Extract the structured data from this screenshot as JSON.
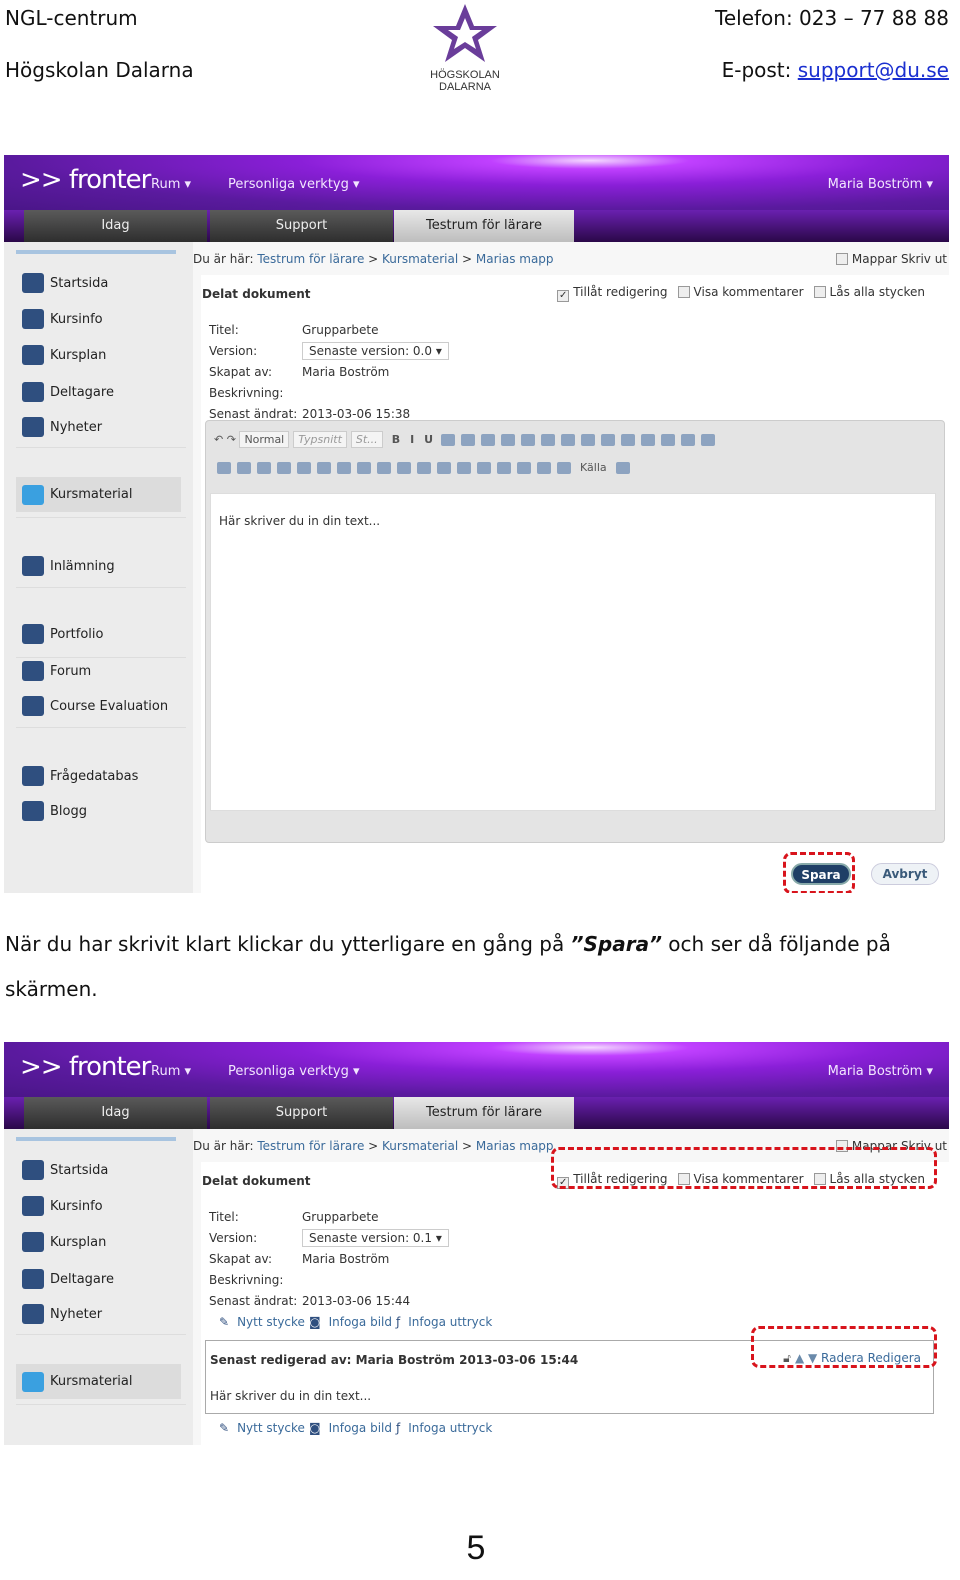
{
  "header": {
    "org": "NGL-centrum",
    "school": "Högskolan Dalarna",
    "logo_text": [
      "HÖGSKOLAN",
      "DALARNA"
    ],
    "phone": "Telefon: 023 – 77 88 88",
    "email_label": "E-post: ",
    "email": "support@du.se"
  },
  "caption": {
    "before": "När du har skrivit klart klickar du ytterligare en gång på ",
    "emph": "”Spara”",
    "after": " och ser då följande på",
    "line2": "skärmen."
  },
  "page_number": "5",
  "app": {
    "logo": ">> fronter",
    "nav_rum": "Rum ▾",
    "nav_tools": "Personliga verktyg ▾",
    "user": "Maria Boström ▾",
    "tabs": [
      "Idag",
      "Support",
      "Testrum för lärare"
    ],
    "sidebar": [
      "Startsida",
      "Kursinfo",
      "Kursplan",
      "Deltagare",
      "Nyheter",
      "Kursmaterial",
      "Inlämning",
      "Portfolio",
      "Forum",
      "Course Evaluation",
      "Frågedatabas",
      "Blogg"
    ],
    "crumb_prefix": "Du är här: ",
    "crumbs": [
      "Testrum för lärare",
      "Kursmaterial",
      "Marias mapp"
    ],
    "mappar": "Mappar",
    "skriv_ut": "Skriv ut",
    "doc_title": "Delat dokument",
    "options": [
      "Tillåt redigering",
      "Visa kommentarer",
      "Lås alla stycken"
    ],
    "labels": [
      "Titel:",
      "Version:",
      "Skapat av:",
      "Beskrivning:",
      "Senast ändrat:"
    ],
    "title": "Grupparbete",
    "author": "Maria Boström"
  },
  "shot1": {
    "version": "Senaste version: 0.0",
    "modified": "2013-03-06 15:38",
    "toolbar": {
      "format": "Normal",
      "font": "Typsnitt",
      "size": "St...",
      "source": "Källa"
    },
    "editor_text": "Här skriver du in din text...",
    "save": "Spara",
    "cancel": "Avbryt"
  },
  "shot2": {
    "version": "Senaste version: 0.1",
    "modified": "2013-03-06 15:44",
    "actions": [
      "Nytt stycke",
      "Infoga bild",
      "Infoga uttryck"
    ],
    "last_edited": "Senast redigerad av: Maria Boström 2013-03-06 15:44",
    "para_text": "Här skriver du in din text...",
    "para_actions": [
      "Radera",
      "Redigera"
    ]
  },
  "colors": {
    "accent_red": "#d8141c",
    "link": "#3a6a9a",
    "banner": "#8a1fd8"
  }
}
